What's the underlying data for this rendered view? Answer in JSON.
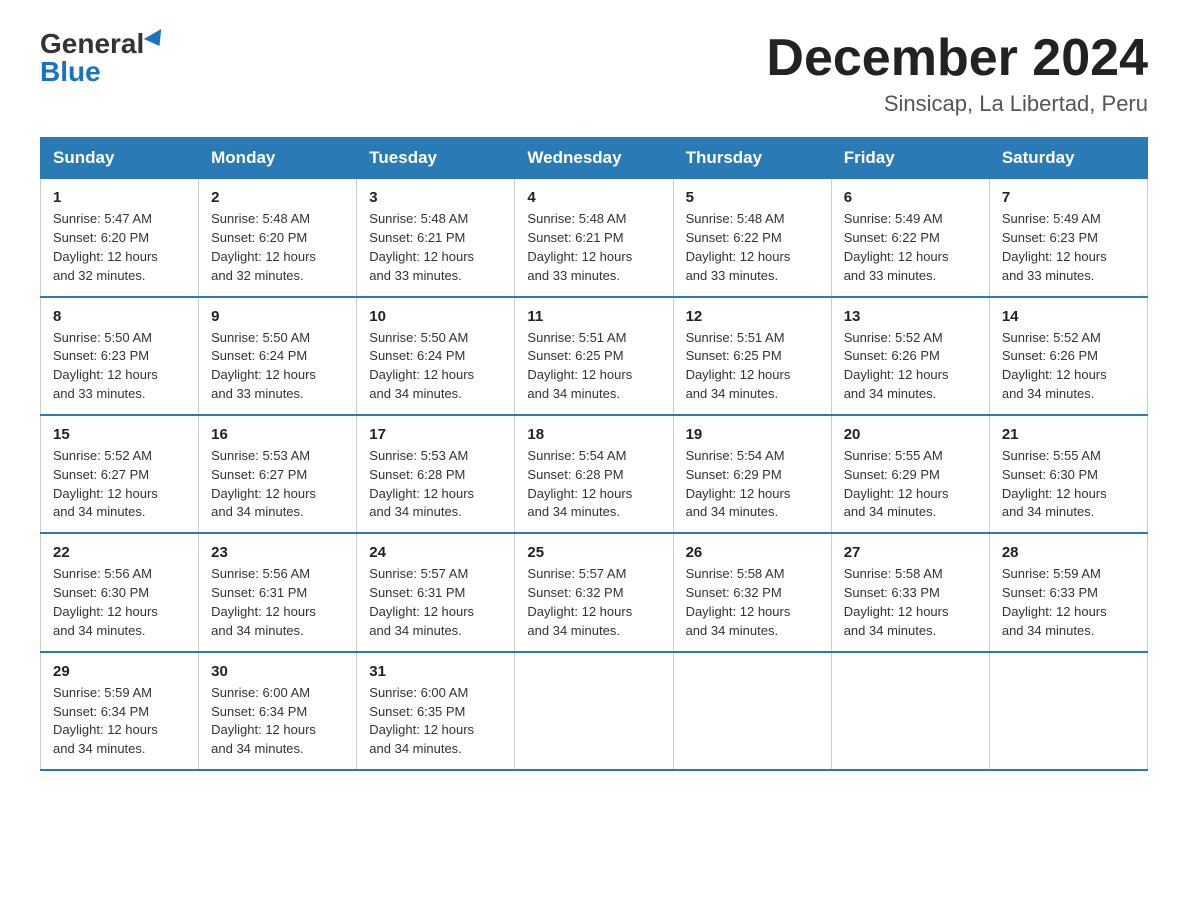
{
  "logo": {
    "general": "General",
    "blue": "Blue",
    "triangle": "▲"
  },
  "title": "December 2024",
  "subtitle": "Sinsicap, La Libertad, Peru",
  "headers": [
    "Sunday",
    "Monday",
    "Tuesday",
    "Wednesday",
    "Thursday",
    "Friday",
    "Saturday"
  ],
  "weeks": [
    [
      {
        "day": "1",
        "info": "Sunrise: 5:47 AM\nSunset: 6:20 PM\nDaylight: 12 hours\nand 32 minutes."
      },
      {
        "day": "2",
        "info": "Sunrise: 5:48 AM\nSunset: 6:20 PM\nDaylight: 12 hours\nand 32 minutes."
      },
      {
        "day": "3",
        "info": "Sunrise: 5:48 AM\nSunset: 6:21 PM\nDaylight: 12 hours\nand 33 minutes."
      },
      {
        "day": "4",
        "info": "Sunrise: 5:48 AM\nSunset: 6:21 PM\nDaylight: 12 hours\nand 33 minutes."
      },
      {
        "day": "5",
        "info": "Sunrise: 5:48 AM\nSunset: 6:22 PM\nDaylight: 12 hours\nand 33 minutes."
      },
      {
        "day": "6",
        "info": "Sunrise: 5:49 AM\nSunset: 6:22 PM\nDaylight: 12 hours\nand 33 minutes."
      },
      {
        "day": "7",
        "info": "Sunrise: 5:49 AM\nSunset: 6:23 PM\nDaylight: 12 hours\nand 33 minutes."
      }
    ],
    [
      {
        "day": "8",
        "info": "Sunrise: 5:50 AM\nSunset: 6:23 PM\nDaylight: 12 hours\nand 33 minutes."
      },
      {
        "day": "9",
        "info": "Sunrise: 5:50 AM\nSunset: 6:24 PM\nDaylight: 12 hours\nand 33 minutes."
      },
      {
        "day": "10",
        "info": "Sunrise: 5:50 AM\nSunset: 6:24 PM\nDaylight: 12 hours\nand 34 minutes."
      },
      {
        "day": "11",
        "info": "Sunrise: 5:51 AM\nSunset: 6:25 PM\nDaylight: 12 hours\nand 34 minutes."
      },
      {
        "day": "12",
        "info": "Sunrise: 5:51 AM\nSunset: 6:25 PM\nDaylight: 12 hours\nand 34 minutes."
      },
      {
        "day": "13",
        "info": "Sunrise: 5:52 AM\nSunset: 6:26 PM\nDaylight: 12 hours\nand 34 minutes."
      },
      {
        "day": "14",
        "info": "Sunrise: 5:52 AM\nSunset: 6:26 PM\nDaylight: 12 hours\nand 34 minutes."
      }
    ],
    [
      {
        "day": "15",
        "info": "Sunrise: 5:52 AM\nSunset: 6:27 PM\nDaylight: 12 hours\nand 34 minutes."
      },
      {
        "day": "16",
        "info": "Sunrise: 5:53 AM\nSunset: 6:27 PM\nDaylight: 12 hours\nand 34 minutes."
      },
      {
        "day": "17",
        "info": "Sunrise: 5:53 AM\nSunset: 6:28 PM\nDaylight: 12 hours\nand 34 minutes."
      },
      {
        "day": "18",
        "info": "Sunrise: 5:54 AM\nSunset: 6:28 PM\nDaylight: 12 hours\nand 34 minutes."
      },
      {
        "day": "19",
        "info": "Sunrise: 5:54 AM\nSunset: 6:29 PM\nDaylight: 12 hours\nand 34 minutes."
      },
      {
        "day": "20",
        "info": "Sunrise: 5:55 AM\nSunset: 6:29 PM\nDaylight: 12 hours\nand 34 minutes."
      },
      {
        "day": "21",
        "info": "Sunrise: 5:55 AM\nSunset: 6:30 PM\nDaylight: 12 hours\nand 34 minutes."
      }
    ],
    [
      {
        "day": "22",
        "info": "Sunrise: 5:56 AM\nSunset: 6:30 PM\nDaylight: 12 hours\nand 34 minutes."
      },
      {
        "day": "23",
        "info": "Sunrise: 5:56 AM\nSunset: 6:31 PM\nDaylight: 12 hours\nand 34 minutes."
      },
      {
        "day": "24",
        "info": "Sunrise: 5:57 AM\nSunset: 6:31 PM\nDaylight: 12 hours\nand 34 minutes."
      },
      {
        "day": "25",
        "info": "Sunrise: 5:57 AM\nSunset: 6:32 PM\nDaylight: 12 hours\nand 34 minutes."
      },
      {
        "day": "26",
        "info": "Sunrise: 5:58 AM\nSunset: 6:32 PM\nDaylight: 12 hours\nand 34 minutes."
      },
      {
        "day": "27",
        "info": "Sunrise: 5:58 AM\nSunset: 6:33 PM\nDaylight: 12 hours\nand 34 minutes."
      },
      {
        "day": "28",
        "info": "Sunrise: 5:59 AM\nSunset: 6:33 PM\nDaylight: 12 hours\nand 34 minutes."
      }
    ],
    [
      {
        "day": "29",
        "info": "Sunrise: 5:59 AM\nSunset: 6:34 PM\nDaylight: 12 hours\nand 34 minutes."
      },
      {
        "day": "30",
        "info": "Sunrise: 6:00 AM\nSunset: 6:34 PM\nDaylight: 12 hours\nand 34 minutes."
      },
      {
        "day": "31",
        "info": "Sunrise: 6:00 AM\nSunset: 6:35 PM\nDaylight: 12 hours\nand 34 minutes."
      },
      null,
      null,
      null,
      null
    ]
  ]
}
